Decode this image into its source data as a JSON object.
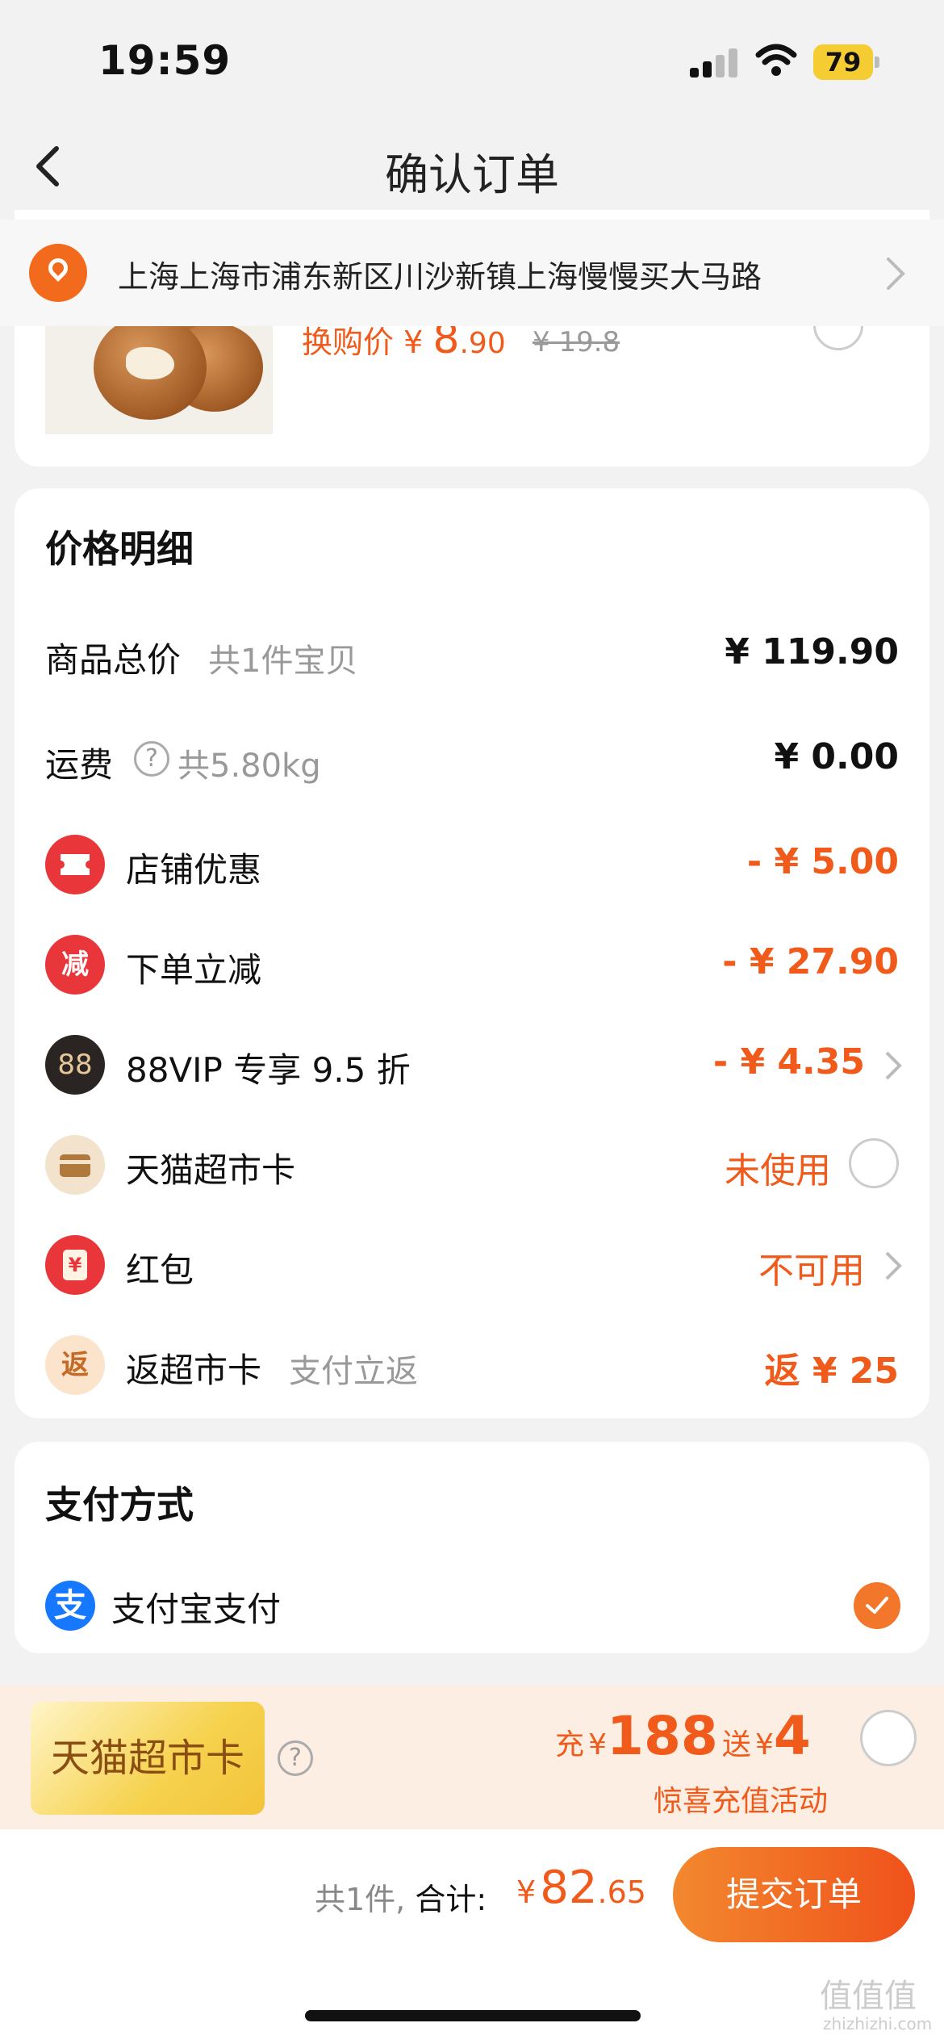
{
  "status_bar": {
    "time": "19:59",
    "battery": "79"
  },
  "header": {
    "title": "确认订单"
  },
  "address": {
    "text": "上海上海市浦东新区川沙新镇上海慢慢买大马路"
  },
  "product": {
    "swap_label": "换购价",
    "currency": "¥",
    "price_int": "8",
    "price_dec": ".90",
    "original_price": "¥ 19.8"
  },
  "price_detail": {
    "title": "价格明细",
    "rows": [
      {
        "label": "商品总价",
        "sub": "共1件宝贝",
        "value": "¥ 119.90"
      },
      {
        "label": "运费",
        "sub": "共5.80kg",
        "value": "¥ 0.00"
      },
      {
        "label": "店铺优惠",
        "value": "- ¥ 5.00"
      },
      {
        "label": "下单立减",
        "icon_text": "减",
        "value": "- ¥ 27.90"
      },
      {
        "label": "88VIP 专享 9.5 折",
        "icon_text": "88",
        "value": "- ¥ 4.35"
      },
      {
        "label": "天猫超市卡",
        "value": "未使用"
      },
      {
        "label": "红包",
        "icon_text": "¥",
        "value": "不可用"
      },
      {
        "label": "返超市卡",
        "sub": "支付立返",
        "icon_text": "返",
        "value": "返 ¥ 25"
      }
    ]
  },
  "payment": {
    "title": "支付方式",
    "method": "支付宝支付",
    "icon_text": "支"
  },
  "promo": {
    "card_text": "天猫超市卡",
    "charge_label": "充",
    "currency": "¥",
    "charge_amount": "188",
    "gift_label": "送",
    "gift_amount": "4",
    "desc": "惊喜充值活动"
  },
  "footer": {
    "count": "共1件,",
    "total_label": "合计:",
    "currency": "¥",
    "total_int": "82",
    "total_dec": ".65",
    "submit": "提交订单"
  },
  "watermark": {
    "text": "值值值",
    "sub": "zhizhizhi.com"
  },
  "colors": {
    "accent": "#f05a1a",
    "red_icon": "#e8363a",
    "alipay": "#1677ff"
  }
}
